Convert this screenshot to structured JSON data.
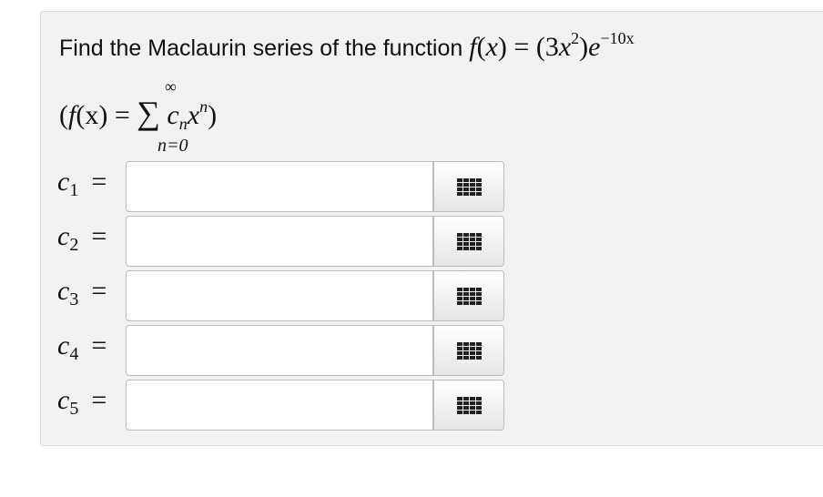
{
  "question": {
    "prompt_text": "Find the Maclaurin series of the function ",
    "function_expr": {
      "f": "f",
      "lparen": "(",
      "x": "x",
      "rparen": ")",
      "eq": " = ",
      "body_start": "(3",
      "body_x": "x",
      "body_exp": "2",
      "body_close": ")",
      "e": "e",
      "e_exp": "−10x"
    },
    "series_form": {
      "lead": "(",
      "f": "f",
      "args": "(x)",
      "eq": " = ",
      "sigma": "∑",
      "term_c": "c",
      "term_sub": "n",
      "term_x": "x",
      "term_exp": "n",
      "trail": ")",
      "upper_limit": "∞",
      "lower_limit": "n=0"
    }
  },
  "coefficients": [
    {
      "var": "c",
      "index": "1",
      "eq": "=",
      "value": ""
    },
    {
      "var": "c",
      "index": "2",
      "eq": "=",
      "value": ""
    },
    {
      "var": "c",
      "index": "3",
      "eq": "=",
      "value": ""
    },
    {
      "var": "c",
      "index": "4",
      "eq": "=",
      "value": ""
    },
    {
      "var": "c",
      "index": "5",
      "eq": "=",
      "value": ""
    }
  ],
  "keypad_icon": "keypad-grid-icon",
  "colors": {
    "panel_bg": "#f2f2f2",
    "panel_border": "#d9d9d9",
    "input_border": "#bdbdbd",
    "icon": "#222222"
  }
}
